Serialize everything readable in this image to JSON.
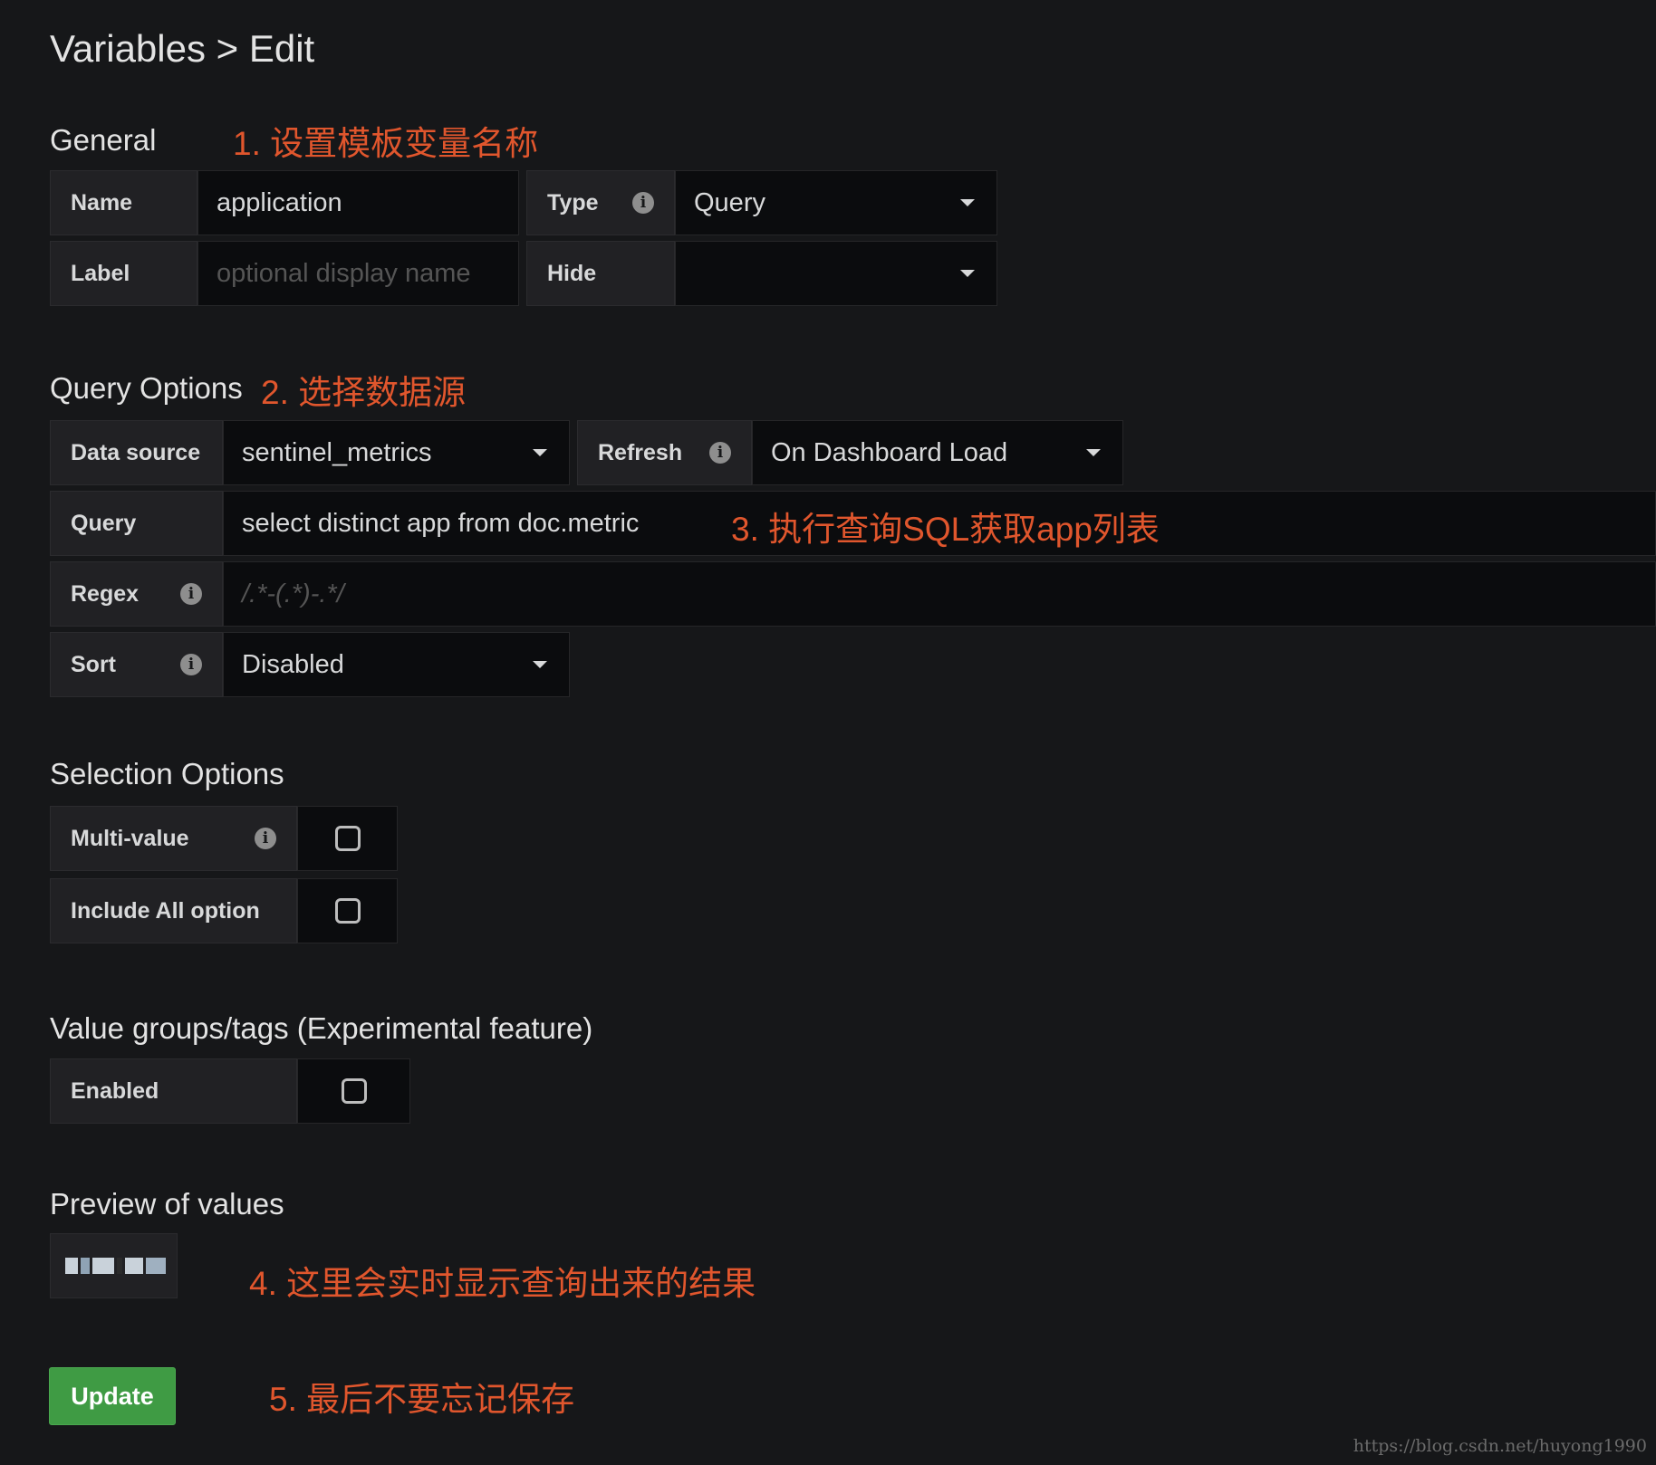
{
  "page": {
    "title": "Variables > Edit"
  },
  "general": {
    "heading": "General",
    "annotation": "1. 设置模板变量名称",
    "name_label": "Name",
    "name_value": "application",
    "type_label": "Type",
    "type_value": "Query",
    "label_label": "Label",
    "label_placeholder": "optional display name",
    "hide_label": "Hide",
    "hide_value": ""
  },
  "query_options": {
    "heading": "Query Options",
    "annotation": "2. 选择数据源",
    "datasource_label": "Data source",
    "datasource_value": "sentinel_metrics",
    "refresh_label": "Refresh",
    "refresh_value": "On Dashboard Load",
    "query_label": "Query",
    "query_value": "select distinct app from doc.metric",
    "query_annotation": "3. 执行查询SQL获取app列表",
    "regex_label": "Regex",
    "regex_placeholder": "/.*-(.*)-.*/",
    "sort_label": "Sort",
    "sort_value": "Disabled"
  },
  "selection_options": {
    "heading": "Selection Options",
    "multivalue_label": "Multi-value",
    "multivalue_checked": false,
    "include_all_label": "Include All option",
    "include_all_checked": false
  },
  "value_groups": {
    "heading": "Value groups/tags (Experimental feature)",
    "enabled_label": "Enabled",
    "enabled_checked": false
  },
  "preview": {
    "heading": "Preview of values",
    "annotation": "4. 这里会实时显示查询出来的结果"
  },
  "actions": {
    "update_label": "Update",
    "annotation": "5. 最后不要忘记保存"
  },
  "watermark": "https://blog.csdn.net/huyong1990",
  "icons": {
    "info": "info-icon",
    "dropdown": "caret-down-icon",
    "checkbox": "checkbox-icon"
  },
  "colors": {
    "background": "#161719",
    "annotation": "#e0562d",
    "update_button": "#3f9b44"
  }
}
